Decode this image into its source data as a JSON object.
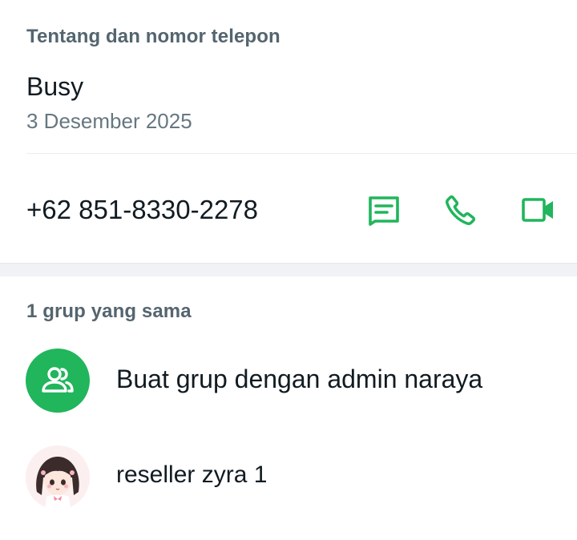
{
  "about": {
    "title": "Tentang dan nomor telepon",
    "status": "Busy",
    "status_date": "3 Desember 2025",
    "phone": "+62 851-8330-2278",
    "actions": {
      "message_icon": "message-icon",
      "call_icon": "phone-icon",
      "video_icon": "video-call-icon"
    }
  },
  "groups": {
    "title": "1 grup yang sama",
    "create_group_label": "Buat grup dengan admin naraya",
    "items": [
      {
        "name": "reseller zyra 1"
      }
    ]
  },
  "colors": {
    "accent": "#21b55c",
    "section_title": "#54656f",
    "secondary_text": "#667781",
    "background": "#f0f2f5"
  }
}
